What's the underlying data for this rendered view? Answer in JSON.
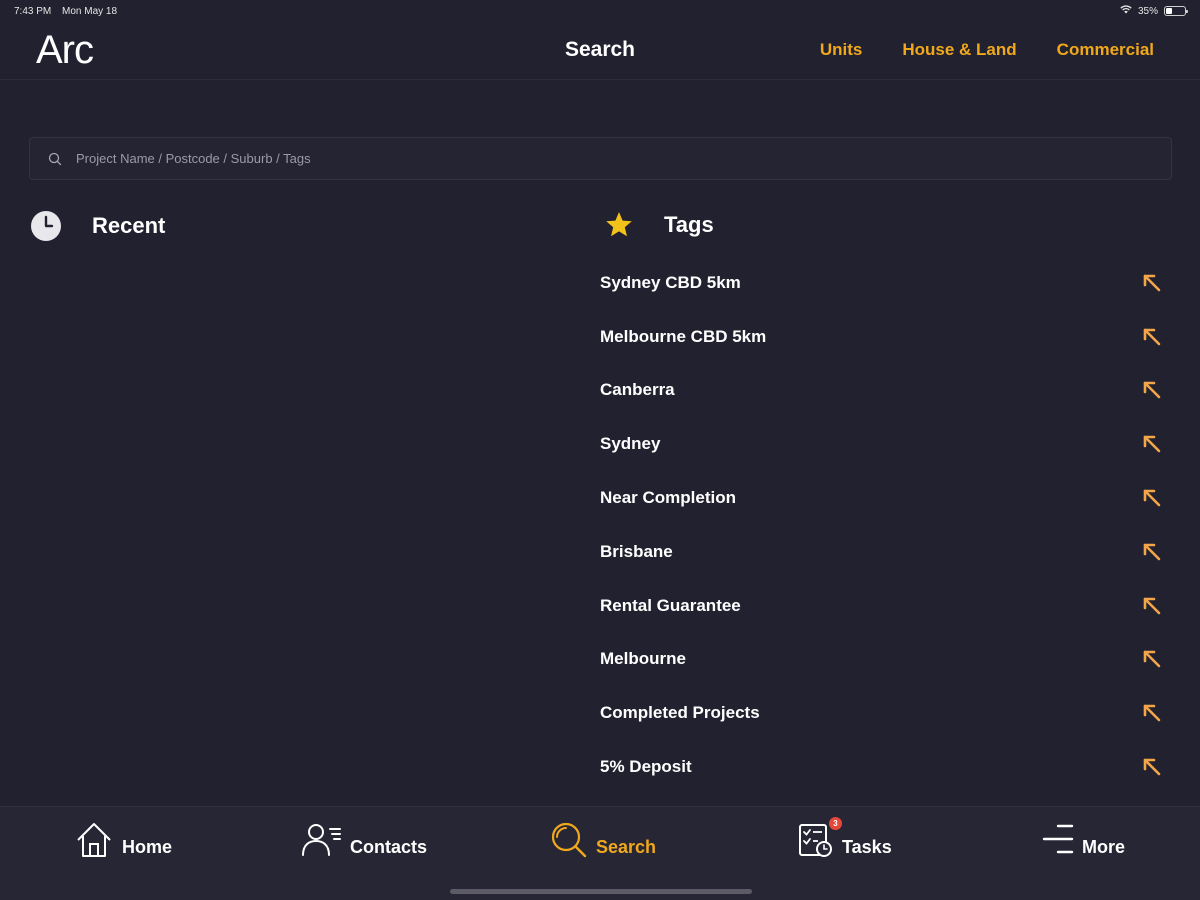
{
  "status_bar": {
    "time": "7:43 PM",
    "date": "Mon May 18",
    "battery": "35%",
    "battery_level": 0.35
  },
  "header": {
    "logo": "Arc",
    "title": "Search",
    "links": [
      "Units",
      "House & Land",
      "Commercial"
    ]
  },
  "search": {
    "placeholder": "Project Name / Postcode / Suburb / Tags",
    "value": ""
  },
  "recent": {
    "title": "Recent",
    "icon": "clock-icon"
  },
  "tags": {
    "title": "Tags",
    "icon": "star-icon",
    "items": [
      "Sydney CBD 5km",
      "Melbourne CBD 5km",
      "Canberra",
      "Sydney",
      "Near Completion",
      "Brisbane",
      "Rental Guarantee",
      "Melbourne",
      "Completed Projects",
      "5% Deposit"
    ]
  },
  "tab_bar": {
    "home": "Home",
    "contacts": "Contacts",
    "search": "Search",
    "tasks": "Tasks",
    "tasks_badge": "3",
    "more": "More"
  },
  "colors": {
    "background": "#22212f",
    "accent": "#f0a81c",
    "arrow": "#f3a54a",
    "badge": "#e5483a"
  }
}
